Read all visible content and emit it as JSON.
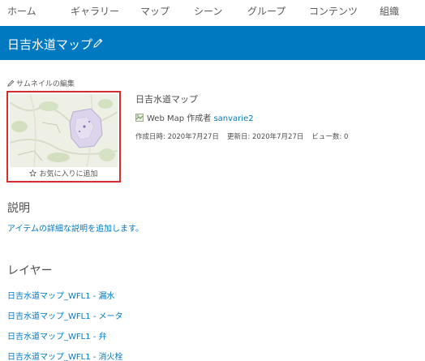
{
  "nav": {
    "items": [
      "ホーム",
      "ギャラリー",
      "マップ",
      "シーン",
      "グループ",
      "コンテンツ",
      "組織"
    ]
  },
  "header": {
    "title": "日吉水道マップ"
  },
  "thumbnail": {
    "edit_label": "サムネイルの編集",
    "favorite_label": "お気に入りに追加"
  },
  "item": {
    "title": "日吉水道マップ",
    "type_label": "Web Map 作成者",
    "owner": "sanvarie2",
    "created": "作成日時: 2020年7月27日",
    "modified": "更新日: 2020年7月27日",
    "views": "ビュー数: 0"
  },
  "description": {
    "heading": "説明",
    "add_link": "アイテムの詳細な説明を追加します。"
  },
  "layers": {
    "heading": "レイヤー",
    "items": [
      "日吉水道マップ_WFL1 - 漏水",
      "日吉水道マップ_WFL1 - メータ",
      "日吉水道マップ_WFL1 - 弁",
      "日吉水道マップ_WFL1 - 消火栓"
    ]
  },
  "colors": {
    "accent": "#0079c1",
    "highlight_border": "#d32f2f"
  }
}
